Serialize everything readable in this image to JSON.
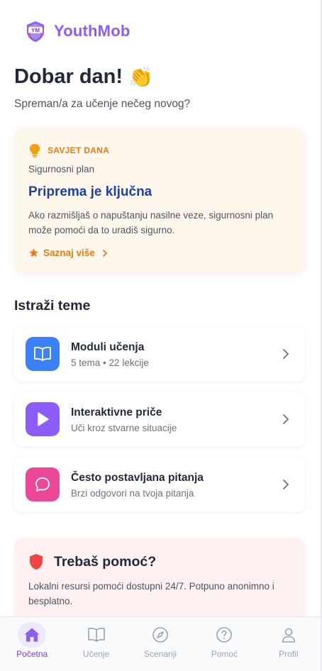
{
  "app": {
    "title": "YouthMob",
    "logo_text": "YM"
  },
  "greeting": {
    "title": "Dobar dan!",
    "emoji": "👏",
    "subtitle": "Spreman/a za učenje nečeg novog?"
  },
  "tip": {
    "tag": "SAVJET DANA",
    "category": "Sigurnosni plan",
    "title": "Priprema je ključna",
    "body": "Ako razmišljaš o napuštanju nasilne veze, sigurnosni plan može pomoći da to uradiš sigurno.",
    "link": "Saznaj više"
  },
  "explore": {
    "title": "Istraži teme",
    "items": [
      {
        "title": "Moduli učenja",
        "meta_modules": "5 tema",
        "meta_sep": "•",
        "meta_lessons": "22 lekcije",
        "icon": "book-open-icon",
        "color": "#3b82f6"
      },
      {
        "title": "Interaktivne priče",
        "subtitle": "Uči kroz stvarne situacije",
        "icon": "play-icon",
        "color": "#8b5cf6"
      },
      {
        "title": "Često postavljana pitanja",
        "subtitle": "Brzi odgovori na tvoja pitanja",
        "icon": "chat-bubble-icon",
        "color": "#ec4899"
      }
    ]
  },
  "help": {
    "title": "Trebaš pomoć?",
    "body": "Lokalni resursi pomoći dostupni 24/7. Potpuno anonimno i besplatno."
  },
  "nav": {
    "items": [
      {
        "label": "Početna",
        "icon": "home-icon",
        "active": true
      },
      {
        "label": "Učenje",
        "icon": "book-icon",
        "active": false
      },
      {
        "label": "Scenariji",
        "icon": "compass-icon",
        "active": false
      },
      {
        "label": "Pomoć",
        "icon": "help-circle-icon",
        "active": false
      },
      {
        "label": "Profil",
        "icon": "user-icon",
        "active": false
      }
    ]
  },
  "colors": {
    "brand": "#8b5cf6",
    "accent_orange": "#ea7b12",
    "tip_title": "#1e40af",
    "help_red": "#ef4444"
  }
}
